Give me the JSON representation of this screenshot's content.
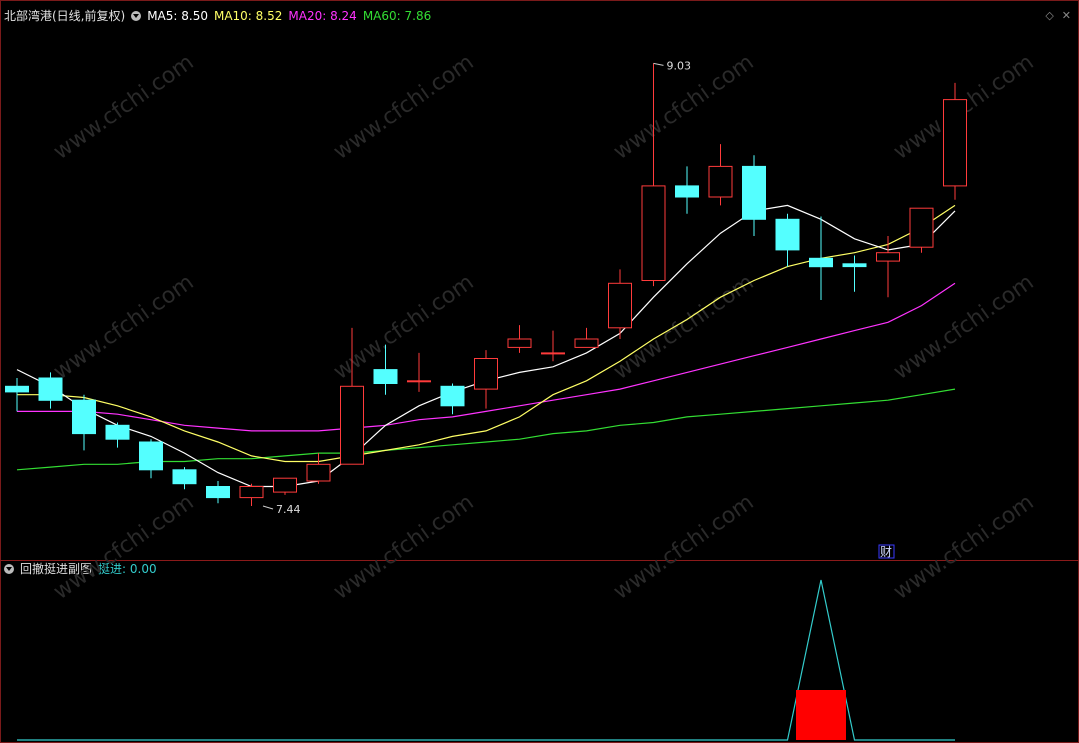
{
  "header": {
    "stock_title": "北部湾港(日线,前复权)",
    "ma5": "MA5: 8.50",
    "ma10": "MA10: 8.52",
    "ma20": "MA20: 8.24",
    "ma60": "MA60: 7.86"
  },
  "sub_header": {
    "indicator_title": "回撤挺进副图",
    "indicator_value": "挺进: 0.00"
  },
  "annotations": {
    "high_label": "9.03",
    "low_label": "7.44",
    "finance_marker": "财"
  },
  "watermark": "www.cfchi.com",
  "colors": {
    "up": "#ff3b3b",
    "down": "#54ffff",
    "ma5": "#ffffff",
    "ma10": "#ffff66",
    "ma20": "#ff33ff",
    "ma60": "#33dd33",
    "indicator": "#33cccc",
    "signal": "#ff0000"
  },
  "chart_data": {
    "type": "candlestick",
    "price_range": [
      7.3,
      9.15
    ],
    "candles": [
      {
        "o": 7.87,
        "c": 7.85,
        "h": 7.9,
        "l": 7.78
      },
      {
        "o": 7.9,
        "c": 7.82,
        "h": 7.92,
        "l": 7.79
      },
      {
        "o": 7.82,
        "c": 7.7,
        "h": 7.84,
        "l": 7.64
      },
      {
        "o": 7.73,
        "c": 7.68,
        "h": 7.74,
        "l": 7.65
      },
      {
        "o": 7.67,
        "c": 7.57,
        "h": 7.68,
        "l": 7.54
      },
      {
        "o": 7.57,
        "c": 7.52,
        "h": 7.58,
        "l": 7.5
      },
      {
        "o": 7.51,
        "c": 7.47,
        "h": 7.53,
        "l": 7.45
      },
      {
        "o": 7.47,
        "c": 7.51,
        "h": 7.52,
        "l": 7.44
      },
      {
        "o": 7.49,
        "c": 7.54,
        "h": 7.54,
        "l": 7.48
      },
      {
        "o": 7.53,
        "c": 7.59,
        "h": 7.63,
        "l": 7.52
      },
      {
        "o": 7.59,
        "c": 7.87,
        "h": 8.08,
        "l": 7.59
      },
      {
        "o": 7.93,
        "c": 7.88,
        "h": 8.02,
        "l": 7.84
      },
      {
        "o": 7.89,
        "c": 7.89,
        "h": 7.99,
        "l": 7.85
      },
      {
        "o": 7.87,
        "c": 7.8,
        "h": 7.88,
        "l": 7.77
      },
      {
        "o": 7.86,
        "c": 7.97,
        "h": 8.0,
        "l": 7.79
      },
      {
        "o": 8.01,
        "c": 8.04,
        "h": 8.09,
        "l": 7.99
      },
      {
        "o": 7.99,
        "c": 7.99,
        "h": 8.07,
        "l": 7.96
      },
      {
        "o": 8.01,
        "c": 8.04,
        "h": 8.08,
        "l": 8.01
      },
      {
        "o": 8.08,
        "c": 8.24,
        "h": 8.29,
        "l": 8.04
      },
      {
        "o": 8.25,
        "c": 8.59,
        "h": 9.03,
        "l": 8.23
      },
      {
        "o": 8.59,
        "c": 8.55,
        "h": 8.66,
        "l": 8.49
      },
      {
        "o": 8.55,
        "c": 8.66,
        "h": 8.74,
        "l": 8.52
      },
      {
        "o": 8.66,
        "c": 8.47,
        "h": 8.7,
        "l": 8.41
      },
      {
        "o": 8.47,
        "c": 8.36,
        "h": 8.49,
        "l": 8.3
      },
      {
        "o": 8.33,
        "c": 8.3,
        "h": 8.48,
        "l": 8.18
      },
      {
        "o": 8.31,
        "c": 8.3,
        "h": 8.34,
        "l": 8.21
      },
      {
        "o": 8.32,
        "c": 8.35,
        "h": 8.41,
        "l": 8.19
      },
      {
        "o": 8.37,
        "c": 8.51,
        "h": 8.51,
        "l": 8.35
      },
      {
        "o": 8.59,
        "c": 8.9,
        "h": 8.96,
        "l": 8.54
      }
    ],
    "ma5": [
      7.93,
      7.87,
      7.79,
      7.73,
      7.69,
      7.63,
      7.56,
      7.51,
      7.51,
      7.53,
      7.62,
      7.73,
      7.8,
      7.85,
      7.89,
      7.92,
      7.94,
      7.99,
      8.06,
      8.19,
      8.31,
      8.42,
      8.5,
      8.52,
      8.47,
      8.4,
      8.36,
      8.38,
      8.5
    ],
    "ma10": [
      7.84,
      7.84,
      7.83,
      7.8,
      7.76,
      7.71,
      7.67,
      7.62,
      7.6,
      7.6,
      7.62,
      7.64,
      7.66,
      7.69,
      7.71,
      7.76,
      7.84,
      7.89,
      7.96,
      8.04,
      8.11,
      8.19,
      8.25,
      8.3,
      8.33,
      8.35,
      8.38,
      8.44,
      8.52
    ],
    "ma20": [
      7.78,
      7.78,
      7.78,
      7.77,
      7.75,
      7.73,
      7.72,
      7.71,
      7.71,
      7.71,
      7.72,
      7.73,
      7.75,
      7.76,
      7.78,
      7.8,
      7.82,
      7.84,
      7.86,
      7.89,
      7.92,
      7.95,
      7.98,
      8.01,
      8.04,
      8.07,
      8.1,
      8.16,
      8.24
    ],
    "ma60": [
      7.57,
      7.58,
      7.59,
      7.59,
      7.6,
      7.6,
      7.61,
      7.61,
      7.62,
      7.63,
      7.63,
      7.64,
      7.65,
      7.66,
      7.67,
      7.68,
      7.7,
      7.71,
      7.73,
      7.74,
      7.76,
      7.77,
      7.78,
      7.79,
      7.8,
      7.81,
      7.82,
      7.84,
      7.86
    ],
    "indicator": {
      "name": "挺进",
      "values": [
        0,
        0,
        0,
        0,
        0,
        0,
        0,
        0,
        0,
        0,
        0,
        0,
        0,
        0,
        0,
        0,
        0,
        0,
        0,
        0,
        0,
        0,
        0,
        0,
        1,
        0,
        0,
        0,
        0
      ],
      "signal_index": 24
    }
  }
}
